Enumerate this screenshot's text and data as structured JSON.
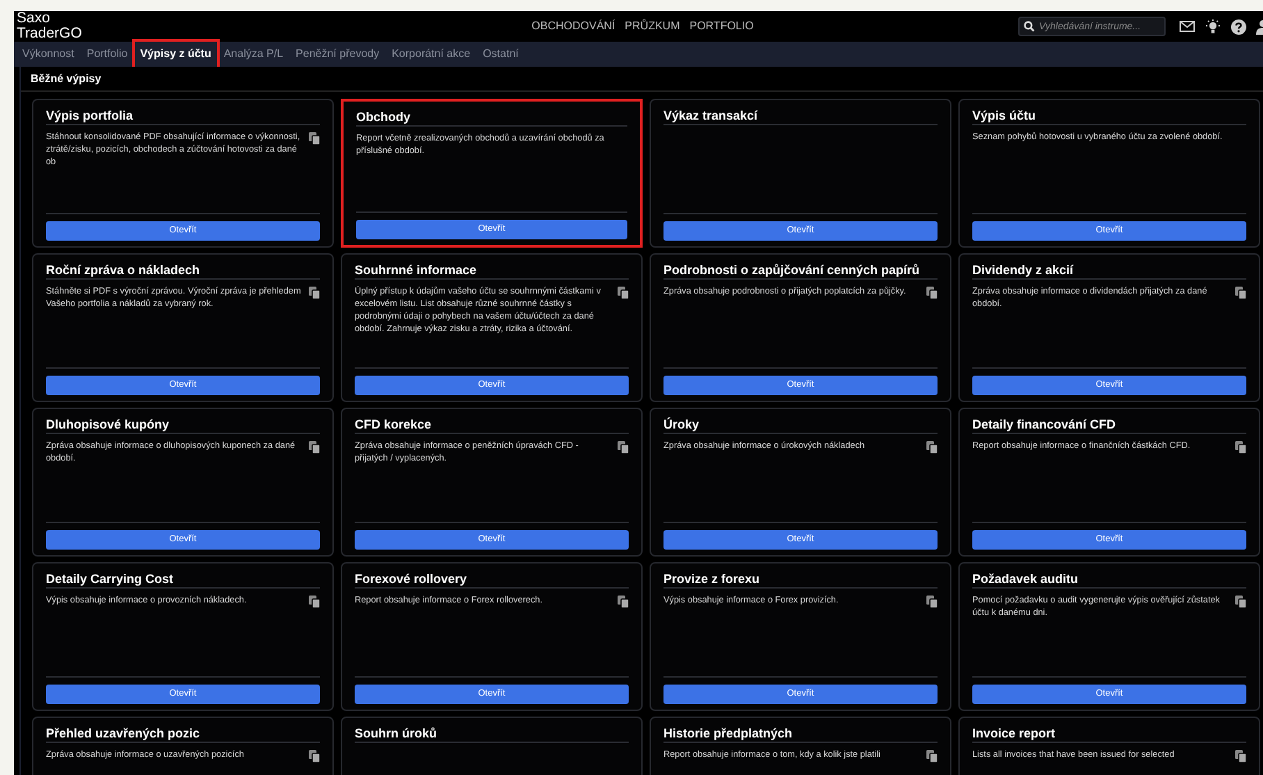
{
  "app": {
    "logo_lines": [
      "Saxo",
      "TraderGO"
    ]
  },
  "nav": [
    "OBCHODOVÁNÍ",
    "PRŮZKUM",
    "PORTFOLIO"
  ],
  "search": {
    "placeholder": "Vyhledávání instrume..."
  },
  "tabs": [
    {
      "label": "Výkonnost",
      "selected": false,
      "highlighted": false
    },
    {
      "label": "Portfolio",
      "selected": false,
      "highlighted": false
    },
    {
      "label": "Výpisy z účtu",
      "selected": true,
      "highlighted": true
    },
    {
      "label": "Analýza P/L",
      "selected": false,
      "highlighted": false
    },
    {
      "label": "Peněžní převody",
      "selected": false,
      "highlighted": false
    },
    {
      "label": "Korporátní akce",
      "selected": false,
      "highlighted": false
    },
    {
      "label": "Ostatní",
      "selected": false,
      "highlighted": false
    }
  ],
  "section_title": "Běžné výpisy",
  "cards": [
    {
      "title": "Výpis portfolia",
      "description": "Stáhnout konsolidované PDF obsahující informace o výkonnosti, ztrátě/zisku, pozicích, obchodech a zúčtování hotovosti za dané ob",
      "copy_icon": true,
      "highlighted": false,
      "button": "Otevřít"
    },
    {
      "title": "Obchody",
      "description": "Report včetně zrealizovaných obchodů a uzavírání obchodů za příslušné období.",
      "copy_icon": false,
      "highlighted": true,
      "button": "Otevřít"
    },
    {
      "title": "Výkaz transakcí",
      "copy_icon": false,
      "highlighted": false,
      "button": "Otevřít"
    },
    {
      "title": "Výpis účtu",
      "description": "Seznam pohybů hotovosti u vybraného účtu za zvolené období.",
      "copy_icon": false,
      "highlighted": false,
      "button": "Otevřít"
    },
    {
      "title": "Roční zpráva o nákladech",
      "description": "Stáhněte si PDF s výroční zprávou. Výroční zpráva je přehledem Vašeho portfolia a nákladů za vybraný rok.",
      "copy_icon": true,
      "highlighted": false,
      "button": "Otevřít"
    },
    {
      "title": "Souhrnné informace",
      "description": "Úplný přístup k údajům vašeho účtu se souhrnnými částkami v excelovém listu. List obsahuje různé souhrnné částky s podrobnými údaji o pohybech na vašem účtu/účtech za dané období. Zahrnuje výkaz zisku a ztráty, rizika a účtování.",
      "copy_icon": true,
      "highlighted": false,
      "button": "Otevřít"
    },
    {
      "title": "Podrobnosti o zapůjčování cenných papírů",
      "description": "Zpráva obsahuje podrobnosti o přijatých poplatcích za půjčky.",
      "copy_icon": true,
      "highlighted": false,
      "button": "Otevřít"
    },
    {
      "title": "Dividendy z akcií",
      "description": "Zpráva obsahuje informace o dividendách přijatých za dané období.",
      "copy_icon": true,
      "highlighted": false,
      "button": "Otevřít"
    },
    {
      "title": "Dluhopisové kupóny",
      "description": "Zpráva obsahuje informace o dluhopisových kuponech za dané období.",
      "copy_icon": true,
      "highlighted": false,
      "button": "Otevřít"
    },
    {
      "title": "CFD korekce",
      "description": "Zpráva obsahuje informace o peněžních úpravách CFD - přijatých / vyplacených.",
      "copy_icon": true,
      "highlighted": false,
      "button": "Otevřít"
    },
    {
      "title": "Úroky",
      "description": "Zpráva obsahuje informace o úrokových nákladech",
      "copy_icon": true,
      "highlighted": false,
      "button": "Otevřít"
    },
    {
      "title": "Detaily financování CFD",
      "description": "Report obsahuje informace o finančních částkách CFD.",
      "copy_icon": true,
      "highlighted": false,
      "button": "Otevřít"
    },
    {
      "title": "Detaily Carrying Cost",
      "description": "Výpis obsahuje informace o provozních nákladech.",
      "copy_icon": true,
      "highlighted": false,
      "button": "Otevřít"
    },
    {
      "title": "Forexové rollovery",
      "description": "Report obsahuje informace o Forex rolloverech.",
      "copy_icon": true,
      "highlighted": false,
      "button": "Otevřít"
    },
    {
      "title": "Provize z forexu",
      "description": "Výpis obsahuje informace o Forex provizích.",
      "copy_icon": true,
      "highlighted": false,
      "button": "Otevřít"
    },
    {
      "title": "Požadavek auditu",
      "description": "Pomocí požadavku o audit vygenerujte výpis ověřující zůstatek účtu k danému dni.",
      "copy_icon": true,
      "highlighted": false,
      "button": "Otevřít"
    },
    {
      "title": "Přehled uzavřených pozic",
      "description": "Zpráva obsahuje informace o uzavřených pozicích",
      "copy_icon": true,
      "highlighted": false
    },
    {
      "title": "Souhrn úroků",
      "copy_icon": false,
      "highlighted": false
    },
    {
      "title": "Historie předplatných",
      "description": "Report obsahuje informace o tom, kdy a kolik jste platili",
      "copy_icon": true,
      "highlighted": false
    },
    {
      "title": "Invoice report",
      "description": "Lists all invoices that have been issued for selected",
      "copy_icon": true,
      "highlighted": false
    }
  ]
}
